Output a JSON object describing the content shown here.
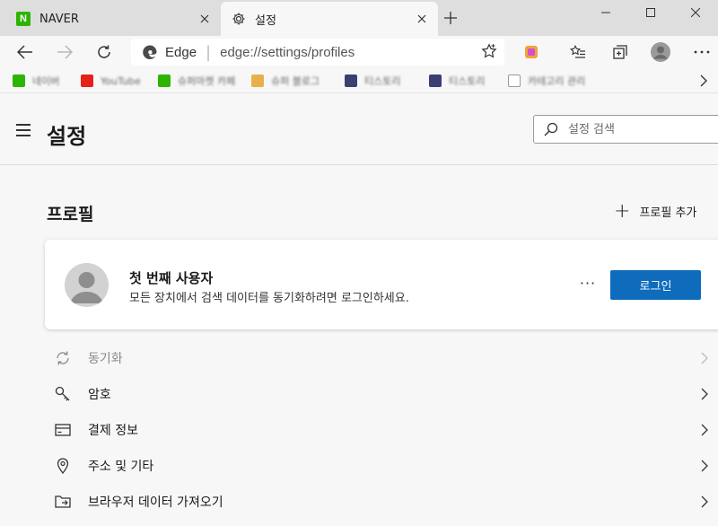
{
  "tabs": [
    {
      "title": "NAVER",
      "favicon": "naver-logo",
      "favicon_text": "N"
    },
    {
      "title": "설정",
      "favicon": "gear-icon"
    }
  ],
  "address_bar": {
    "site_label": "Edge",
    "url": "edge://settings/profiles"
  },
  "bookmarks": [
    {
      "label": "네이버",
      "color": "#2db400"
    },
    {
      "label": "YouTube",
      "color": "#e62117"
    },
    {
      "label": "슈퍼마켓 카페",
      "color": "#2db400"
    },
    {
      "label": "슈퍼 블로그",
      "color": "#e8b04b"
    },
    {
      "label": "티스토리",
      "color": "#3c3f73"
    },
    {
      "label": "티스토리",
      "color": "#3c3f73"
    },
    {
      "label": "카테고리 관리",
      "color": "#9a9a9a"
    }
  ],
  "settings": {
    "title": "설정",
    "search_placeholder": "설정 검색"
  },
  "profiles": {
    "section_title": "프로필",
    "add_profile_label": "프로필 추가",
    "card": {
      "name": "첫 번째 사용자",
      "description": "모든 장치에서 검색 데이터를 동기화하려면 로그인하세요.",
      "more_label": "···",
      "login_label": "로그인"
    }
  },
  "items": [
    {
      "label": "동기화",
      "icon": "sync-icon",
      "enabled": false
    },
    {
      "label": "암호",
      "icon": "key-icon",
      "enabled": true
    },
    {
      "label": "결제 정보",
      "icon": "credit-card-icon",
      "enabled": true
    },
    {
      "label": "주소 및 기타",
      "icon": "location-pin-icon",
      "enabled": true
    },
    {
      "label": "브라우저 데이터 가져오기",
      "icon": "import-folder-icon",
      "enabled": true
    }
  ],
  "colors": {
    "accent": "#0f6cbd",
    "tabstrip": "#dedede",
    "page_background": "#f7f7f7"
  }
}
